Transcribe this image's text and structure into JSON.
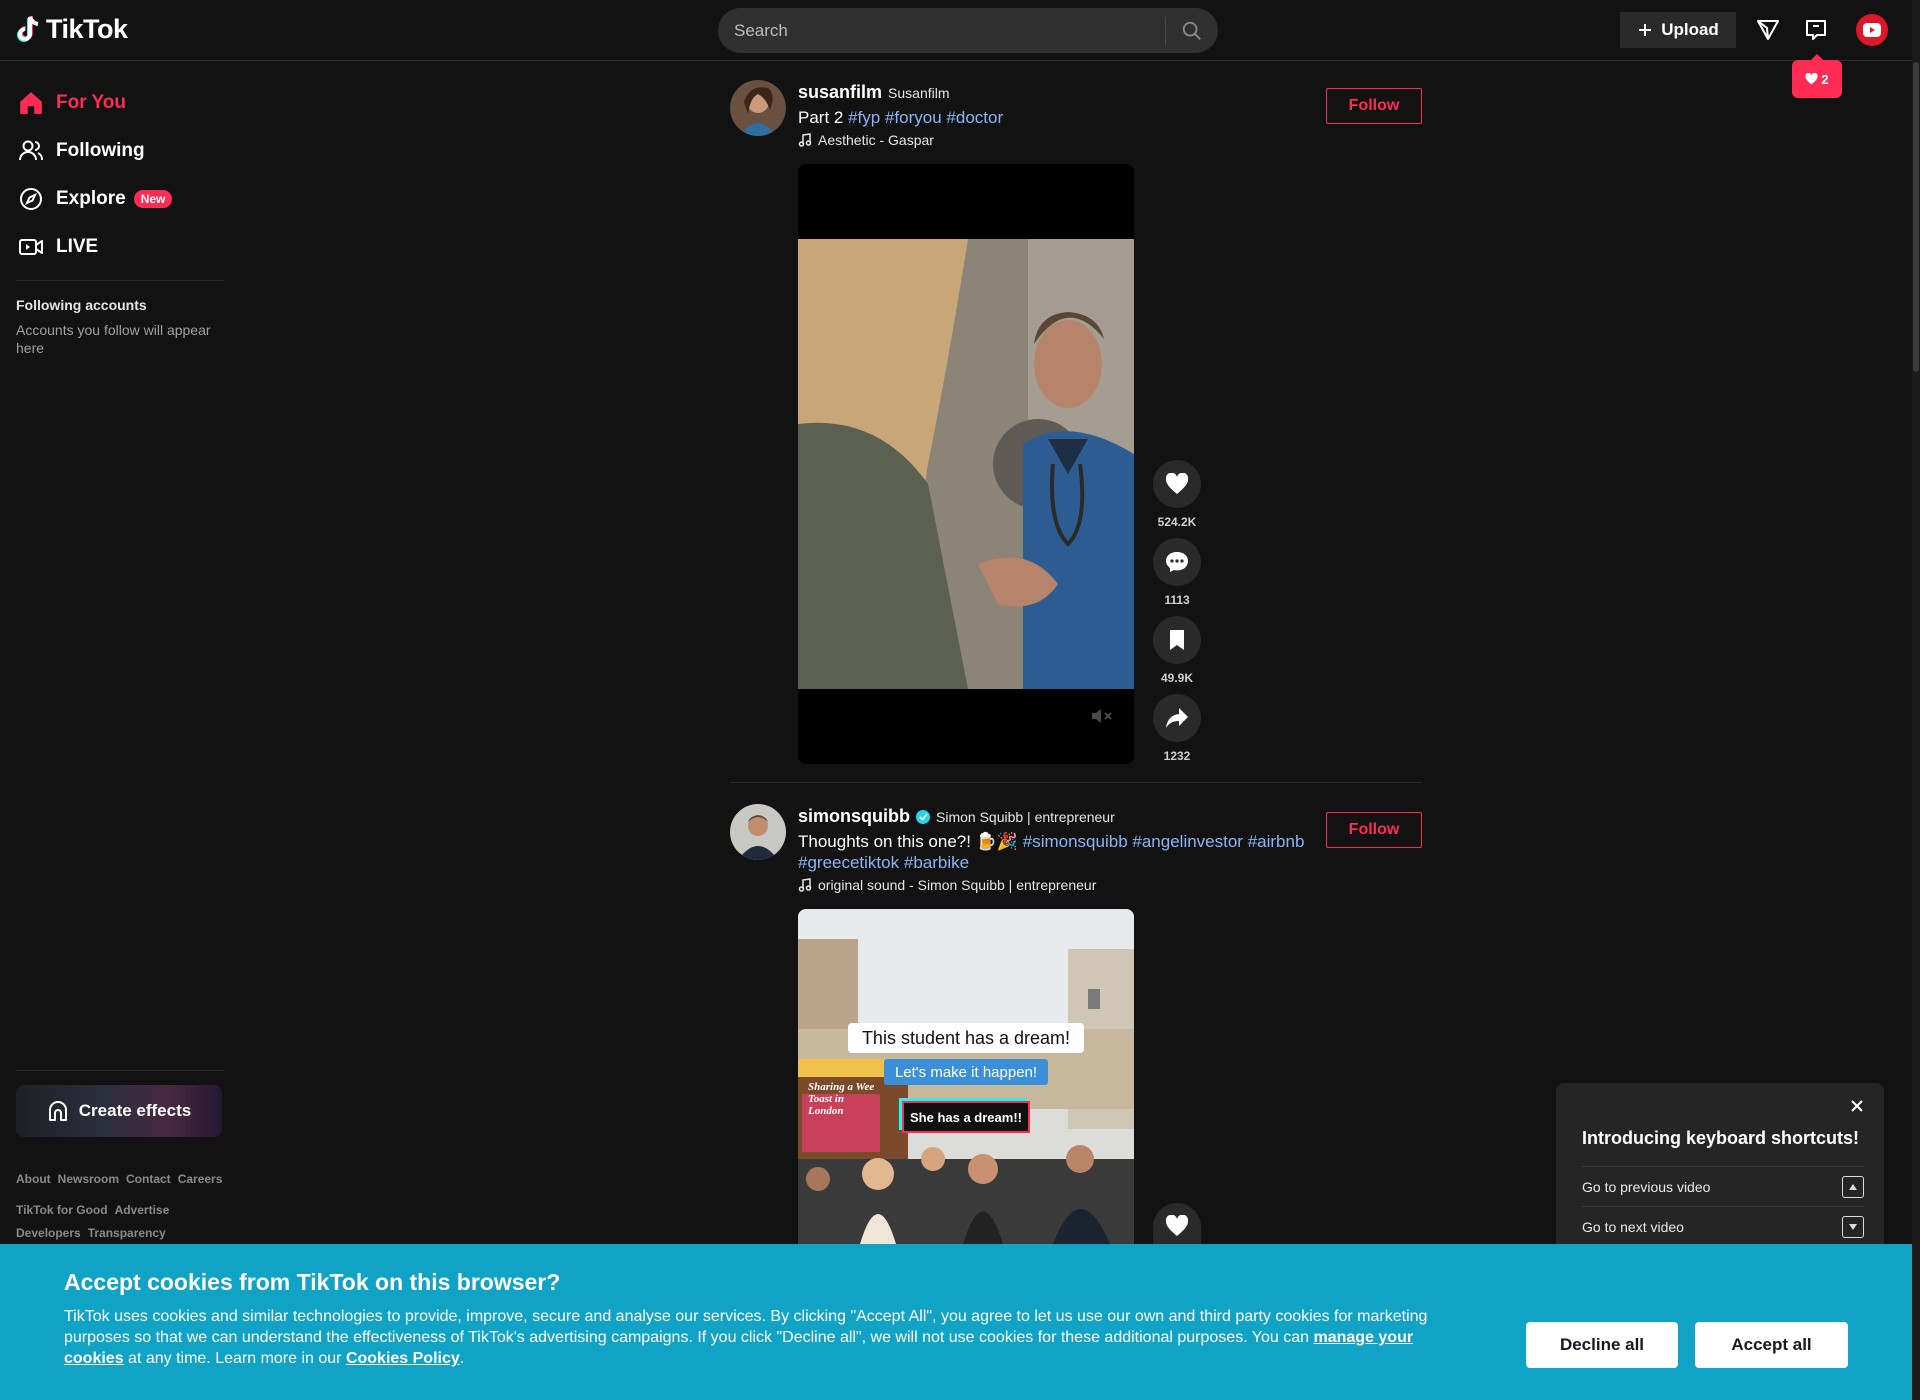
{
  "app": {
    "name": "TikTok"
  },
  "header": {
    "search_placeholder": "Search",
    "upload_label": "Upload",
    "notification_count": "2"
  },
  "sidebar": {
    "nav": [
      {
        "label": "For You",
        "icon": "home-icon",
        "active": true
      },
      {
        "label": "Following",
        "icon": "users-icon"
      },
      {
        "label": "Explore",
        "icon": "compass-icon",
        "badge": "New"
      },
      {
        "label": "LIVE",
        "icon": "live-icon"
      }
    ],
    "following_title": "Following accounts",
    "following_sub": "Accounts you follow will appear here",
    "create_effects": "Create effects",
    "footer_row1": [
      "About",
      "Newsroom",
      "Contact",
      "Careers"
    ],
    "footer_row2": [
      "TikTok for Good",
      "Advertise"
    ],
    "footer_row3": [
      "Developers",
      "Transparency"
    ]
  },
  "posts": [
    {
      "username": "susanfilm",
      "nickname": "Susanfilm",
      "caption_text": "Part 2",
      "tags": [
        "#fyp",
        "#foryou",
        "#doctor"
      ],
      "music": "Aesthetic - Gaspar",
      "follow_label": "Follow",
      "likes": "524.2K",
      "comments": "1113",
      "saves": "49.9K",
      "shares": "1232"
    },
    {
      "username": "simonsquibb",
      "nickname": "Simon Squibb | entrepreneur",
      "caption_text": "Thoughts on this one?! 🍺🎉",
      "tags_line1": [
        "#simonsquibb",
        "#angelinvestor",
        "#airbnb"
      ],
      "tags_line2": [
        "#greecetiktok",
        "#barbike"
      ],
      "music": "original sound - Simon Squibb | entrepreneur",
      "follow_label": "Follow",
      "overlay_1": "This student has a dream!",
      "overlay_2": "Let's make it happen!",
      "overlay_3": "She has a dream!!",
      "sign_text": "Sharing a Wee Toast in London"
    }
  ],
  "shortcuts": {
    "title": "Introducing keyboard shortcuts!",
    "rows": [
      {
        "label": "Go to previous video",
        "key_icon": "arrow-up-key-icon"
      },
      {
        "label": "Go to next video",
        "key_icon": "arrow-down-key-icon"
      }
    ]
  },
  "cookie": {
    "title": "Accept cookies from TikTok on this browser?",
    "text_1": "TikTok uses cookies and similar technologies to provide, improve, secure and analyse our services. By clicking \"Accept All\", you agree to let us use our own and third party cookies for marketing purposes so that we can understand the effectiveness of TikTok's advertising campaigns. If you click \"Decline all\", we will not use cookies for these additional purposes. You can",
    "link_1": "manage your cookies",
    "text_2": "at any time. Learn more in our",
    "link_2": "Cookies Policy",
    "text_3": ".",
    "decline_label": "Decline all",
    "accept_label": "Accept all"
  },
  "colors": {
    "accent": "#fe2c55",
    "background": "#121212",
    "cookie_bg": "#11a3c6",
    "hashtag": "#8ab4f8"
  }
}
